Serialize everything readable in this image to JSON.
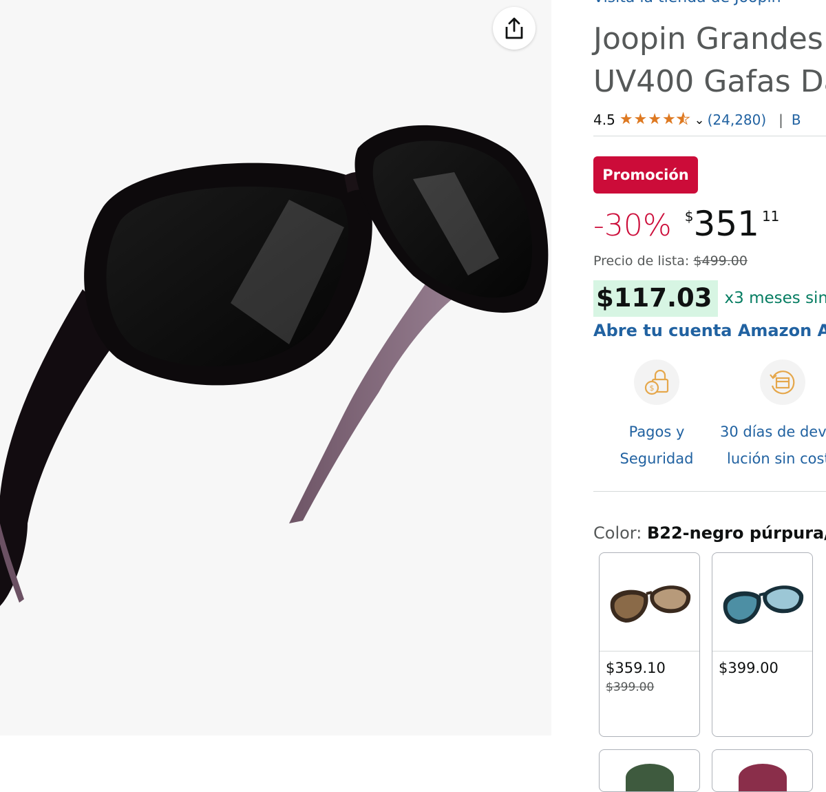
{
  "image": {
    "alt": "sunglasses-main-image",
    "share_icon": "share-icon"
  },
  "product": {
    "store_link": "Visita la tienda de Joopin",
    "title_line1": "Joopin Grandes",
    "title_line2": "UV400 Gafas Da",
    "rating": "4.5",
    "stars": 4.5,
    "reviews": "(24,280)",
    "rating_more": "B"
  },
  "pricing": {
    "promo_badge": "Promoción",
    "discount": "-30%",
    "currency": "$",
    "price_whole": "351",
    "price_fraction": "11",
    "list_label": "Precio de lista:",
    "list_price": "$499.00",
    "installment_amount": "$117.03",
    "installment_text": "x3 meses sin",
    "account_link": "Abre tu cuenta Amazon Ac"
  },
  "features": [
    {
      "icon": "secure-payment-icon",
      "line1": "Pagos y",
      "line2": "Seguridad"
    },
    {
      "icon": "return-box-icon",
      "line1": "30 días de dev",
      "line2": "lución sin cost"
    }
  ],
  "color": {
    "label": "Color:",
    "selected": "B22-negro púrpura/",
    "options": [
      {
        "price": "$359.10",
        "list": "$399.00",
        "icon": "brown-sunglasses-thumbnail"
      },
      {
        "price": "$399.00",
        "list": "",
        "icon": "blue-sunglasses-thumbnail"
      }
    ]
  },
  "colors": {
    "link": "#2162a1",
    "promo": "#cc0c39",
    "installment_bg": "#d7f5e3",
    "installment_text": "#067d62",
    "star": "#de7921"
  }
}
